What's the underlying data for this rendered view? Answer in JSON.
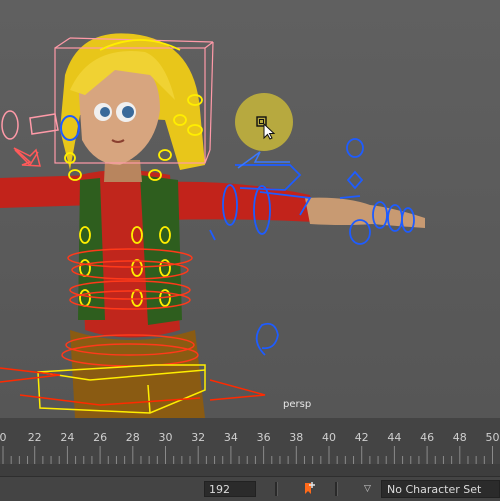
{
  "viewport": {
    "camera_label": "persp"
  },
  "timeline": {
    "ticks": [
      "0",
      "22",
      "24",
      "26",
      "28",
      "30",
      "32",
      "34",
      "36",
      "38",
      "40",
      "42",
      "44",
      "46",
      "48",
      "50"
    ]
  },
  "bottom_bar": {
    "current_frame": "192",
    "character_set": "No Character Set",
    "dropdown_arrow": "▽"
  },
  "icons": {
    "key": "auto-key-icon",
    "cursor": "mouse-cursor-icon"
  },
  "colors": {
    "viewport_bg": "#5e5e5e",
    "control_yellow": "#ffee00",
    "control_blue": "#1e5cff",
    "control_pink": "#ff9aa8",
    "control_red": "#ff2a00"
  }
}
